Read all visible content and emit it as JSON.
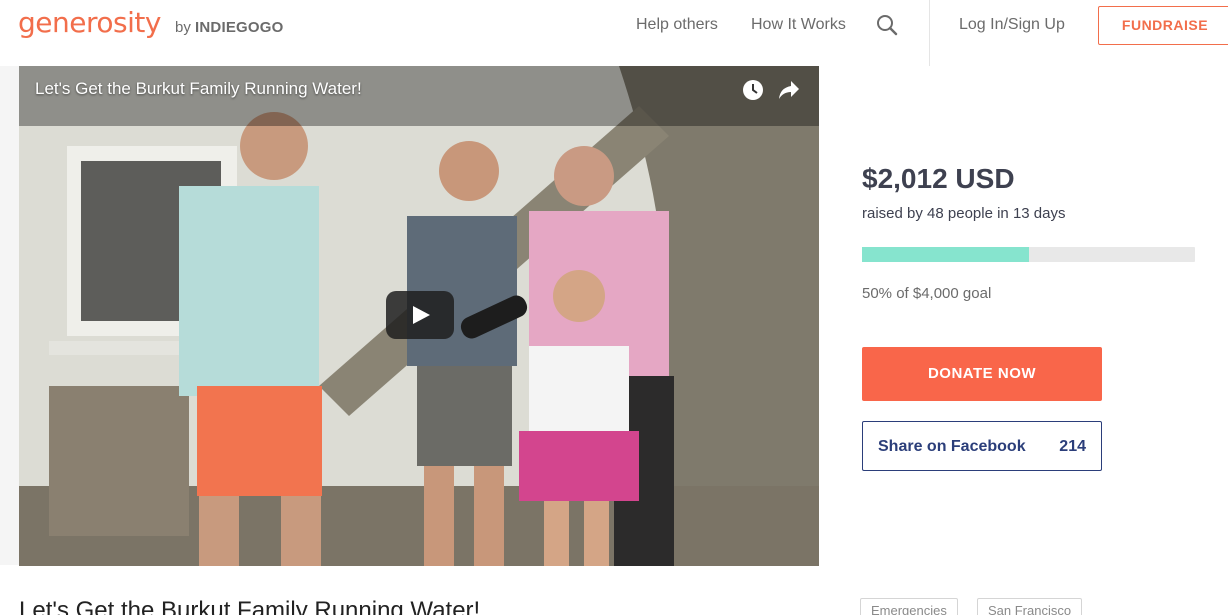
{
  "header": {
    "logo": "generosity",
    "by_prefix": "by",
    "by_brand": "INDIEGOGO",
    "nav": [
      "Help others",
      "How It Works"
    ],
    "login": "Log In/Sign Up",
    "fundraise": "FUNDRAISE"
  },
  "video": {
    "title": "Let's Get the Burkut Family Running Water!"
  },
  "campaign": {
    "amount": "$2,012 USD",
    "raised_text": "raised by 48 people in 13 days",
    "progress_fraction": 0.5,
    "goal_text": "50% of $4,000 goal",
    "donate_label": "DONATE NOW",
    "share_label": "Share on Facebook",
    "share_count": "214",
    "progress_color": "#86e4ce",
    "accent_color": "#f9664a"
  },
  "below": {
    "title": "Let's Get the Burkut Family Running Water!",
    "tags": [
      "Emergencies",
      "San Francisco"
    ]
  }
}
